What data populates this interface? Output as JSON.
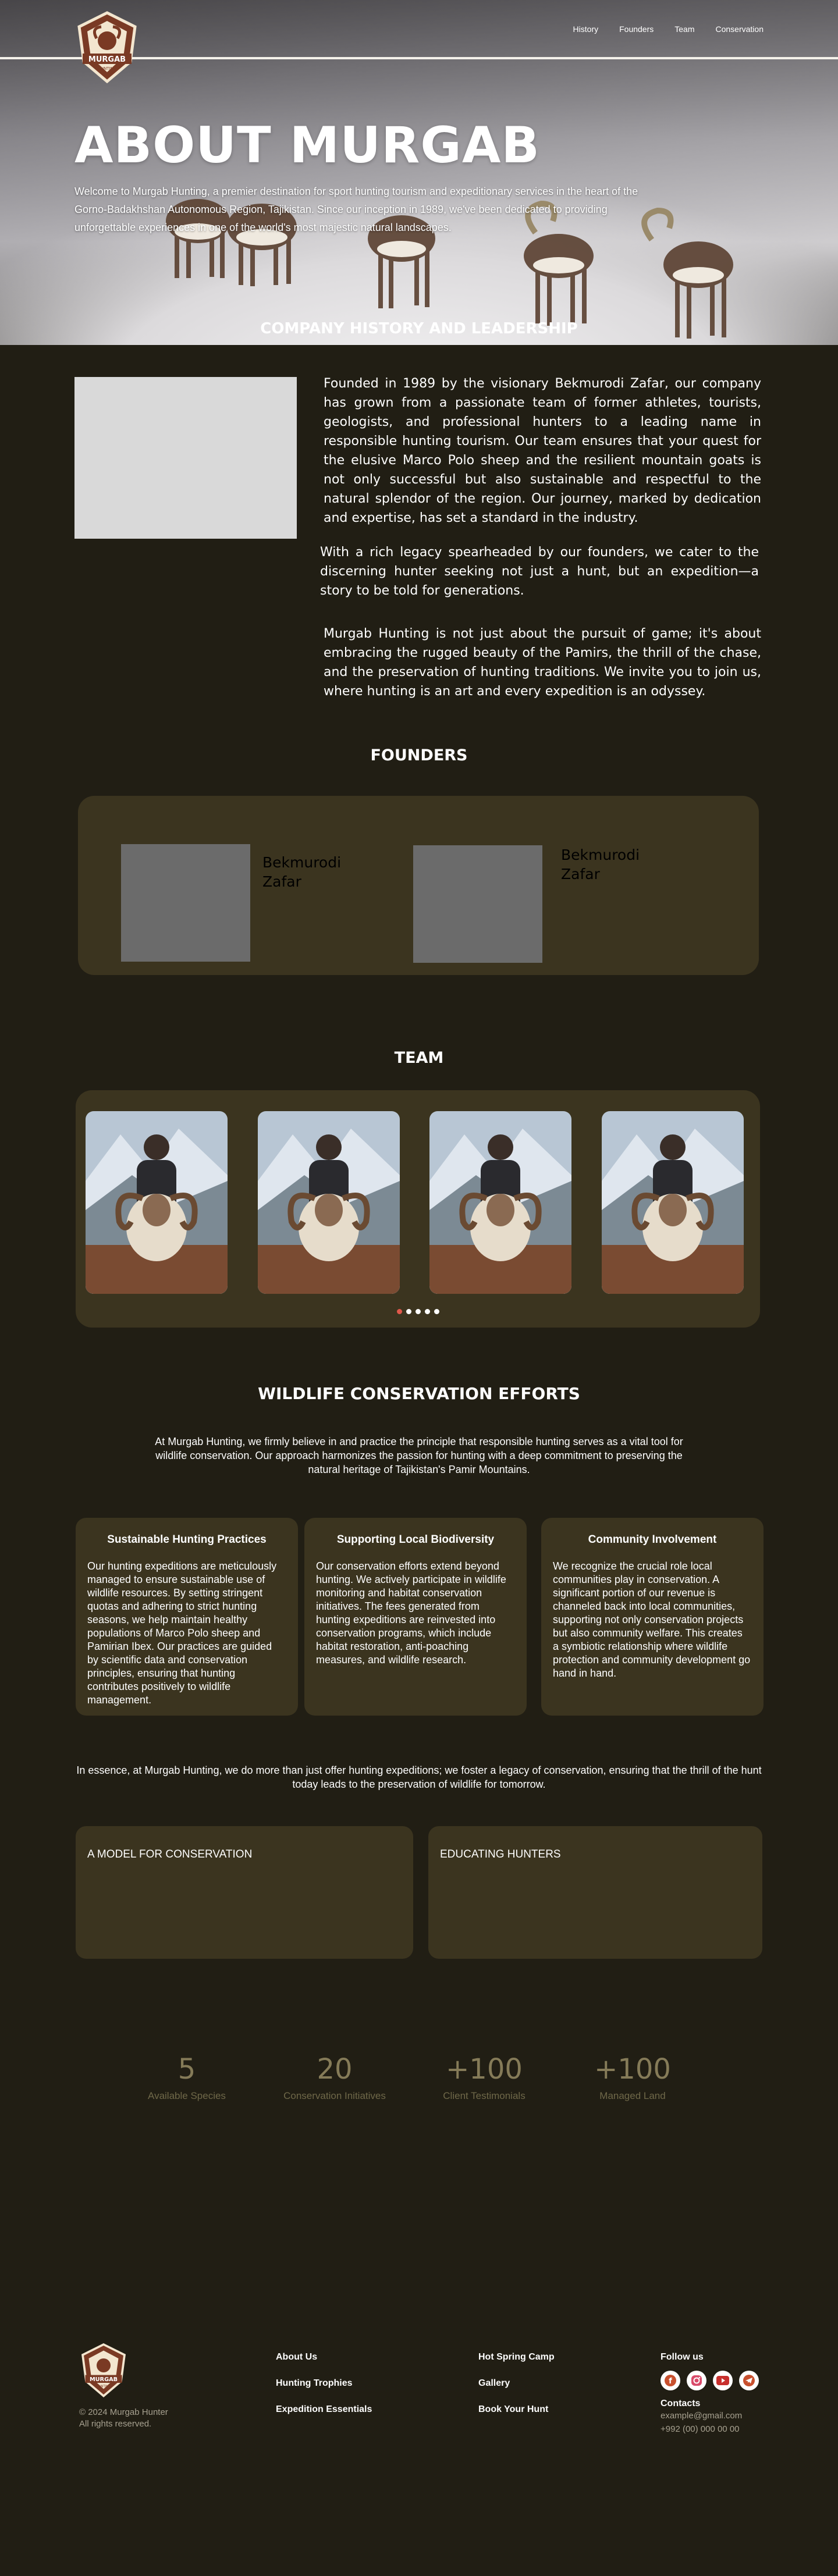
{
  "nav": {
    "logo_text": "MURGAB",
    "logo_sub": "HUNTING",
    "links": [
      "History",
      "Founders",
      "Team",
      "Conservation"
    ]
  },
  "hero": {
    "title": "ABOUT MURGAB",
    "intro": "Welcome to Murgab Hunting, a premier destination for sport hunting tourism and expeditionary services in the heart of the Gorno-Badakhshan Autonomous Region, Tajikistan. Since our inception in 1989, we've been dedicated to providing unforgettable experiences in one of the world's most majestic natural landscapes."
  },
  "history": {
    "title": "COMPANY HISTORY AND LEADERSHIP",
    "p1": "Founded in 1989 by the visionary Bekmurodi Zafar, our company has grown from a passionate team of former athletes, tourists, geologists, and professional hunters to a leading name in responsible hunting tourism. Our team ensures that your quest for the elusive Marco Polo sheep and the resilient mountain goats is not only successful but also sustainable and respectful to the natural splendor of the region. Our journey, marked by dedication and expertise, has set a standard in the industry.",
    "p2": "With a rich legacy spearheaded by our founders, we cater to the discerning hunter seeking not just a hunt, but an expedition—a story to be told for generations.",
    "p3": "Murgab Hunting is not just about the pursuit of game; it's about embracing the rugged beauty of the Pamirs, the thrill of the chase, and the preservation of hunting traditions. We invite you to join us, where hunting is an art and every expedition is an odyssey."
  },
  "founders": {
    "title": "FOUNDERS",
    "people": [
      {
        "name": "Bekmurodi Zafar"
      },
      {
        "name": "Bekmurodi Zafar"
      }
    ]
  },
  "team": {
    "title": "TEAM",
    "members": [
      "member-1",
      "member-2",
      "member-3",
      "member-4"
    ],
    "slides": 5,
    "active_slide": 0
  },
  "wildlife": {
    "title": "WILDLIFE CONSERVATION EFFORTS",
    "lead": "At Murgab Hunting, we firmly believe in and practice the principle that responsible hunting serves as a vital tool for wildlife conservation. Our approach harmonizes the passion for hunting with a deep commitment to preserving the natural heritage of Tajikistan's Pamir Mountains.",
    "cards": [
      {
        "title": "Sustainable Hunting Practices",
        "text": "Our hunting expeditions are meticulously managed to ensure sustainable use of wildlife resources. By setting stringent quotas and adhering to strict hunting seasons, we help maintain healthy populations of Marco Polo sheep and Pamirian Ibex. Our practices are guided by scientific data and conservation principles, ensuring that hunting contributes positively to wildlife management."
      },
      {
        "title": "Supporting Local Biodiversity",
        "text": "Our conservation efforts extend beyond hunting. We actively participate in wildlife monitoring and habitat conservation initiatives. The fees generated from hunting expeditions are reinvested into conservation programs, which include habitat restoration, anti-poaching measures, and wildlife research."
      },
      {
        "title": "Community Involvement",
        "text": "We recognize the crucial role local communities play in conservation. A significant portion of our revenue is channeled back into local communities, supporting not only conservation projects but also community welfare. This creates a symbiotic relationship where wildlife protection and community development go hand in hand."
      }
    ],
    "closing": "In essence, at Murgab Hunting, we do more than just offer hunting expeditions; we foster a legacy of conservation, ensuring that the thrill of the hunt today leads to the preservation of wildlife for tomorrow.",
    "model_title": "A MODEL FOR CONSERVATION",
    "educating_title": "EDUCATING HUNTERS"
  },
  "stats": [
    {
      "value": "5",
      "label": "Available Species"
    },
    {
      "value": "20",
      "label": "Conservation Initiatives"
    },
    {
      "value": "+100",
      "label": "Client Testimonials"
    },
    {
      "value": "+100",
      "label": "Managed Land"
    }
  ],
  "footer": {
    "copyright": "© 2024 Murgab Hunter",
    "rights": "All rights reserved.",
    "col1": [
      "About Us",
      "Hunting Trophies",
      "Expedition Essentials"
    ],
    "col2": [
      "Hot Spring Camp",
      "Gallery",
      "Book Your Hunt"
    ],
    "follow": "Follow us",
    "social_icons": [
      "facebook-icon",
      "instagram-icon",
      "youtube-icon",
      "telegram-icon"
    ],
    "contacts_title": "Contacts",
    "email": "example@gmail.com",
    "phone": "+992 (00) 000 00 00"
  },
  "colors": {
    "background": "#211e14",
    "card": "#3b341f",
    "stat_number": "#857b58",
    "accent_dot": "#e0584b"
  }
}
